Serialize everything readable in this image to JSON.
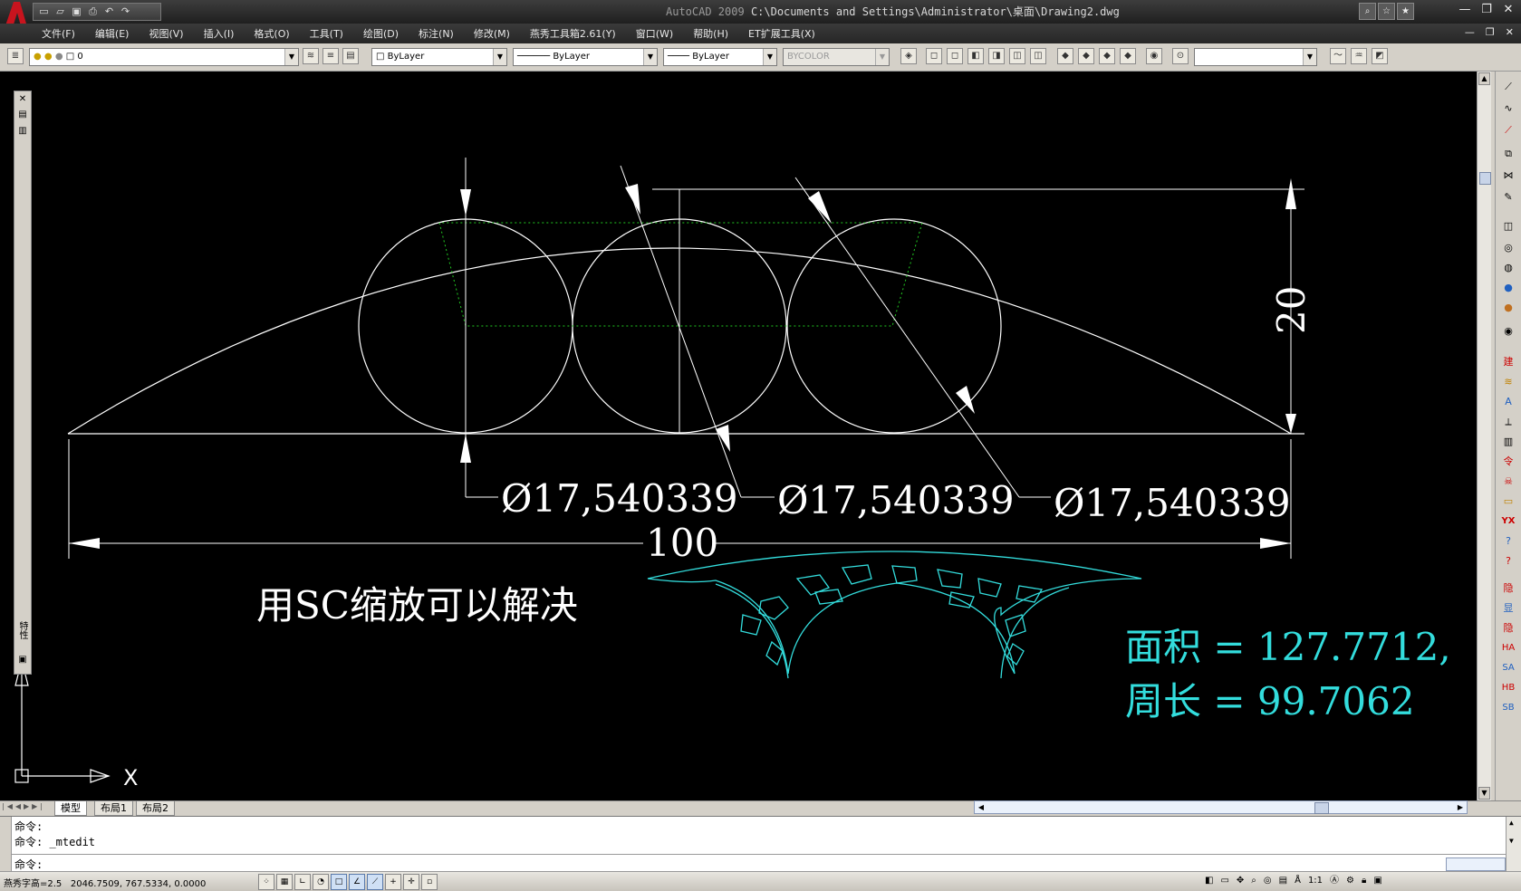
{
  "app": {
    "title_prefix": "AutoCAD 2009",
    "title_path": "C:\\Documents and Settings\\Administrator\\桌面\\Drawing2.dwg",
    "window_buttons": [
      "—",
      "❐",
      "✕"
    ]
  },
  "quick_access": [
    "new-icon",
    "open-icon",
    "save-icon",
    "print-icon",
    "undo-icon",
    "redo-icon"
  ],
  "menu": {
    "items": [
      "文件(F)",
      "编辑(E)",
      "视图(V)",
      "插入(I)",
      "格式(O)",
      "工具(T)",
      "绘图(D)",
      "标注(N)",
      "修改(M)",
      "燕秀工具箱2.61(Y)",
      "窗口(W)",
      "帮助(H)",
      "ET扩展工具(X)"
    ],
    "mdi_buttons": [
      "—",
      "❐",
      "✕"
    ]
  },
  "properties_toolbar": {
    "layer": "0",
    "color": "ByLayer",
    "linetype": "ByLayer",
    "lineweight": "ByLayer",
    "plotstyle": "BYCOLOR"
  },
  "drawing": {
    "dimensions": {
      "diameter_1": "Ø17,540339",
      "diameter_2": "Ø17,540339",
      "diameter_3": "Ø17,540339",
      "width": "100",
      "height": "20"
    },
    "note": "用SC缩放可以解决",
    "area_line": "面积 = 127.7712,",
    "perimeter_line": "周长 = 99.7062",
    "ucs_x_label": "X",
    "colors": {
      "background": "#000000",
      "lines": "#ffffff",
      "construction": "#22cc22",
      "hatch": "#33dddd",
      "measure_text": "#33dddd"
    }
  },
  "palette": {
    "title": "特性"
  },
  "right_toolbar": [
    "建",
    "显",
    "隐",
    "HA",
    "SA",
    "HB",
    "SB",
    "YX"
  ],
  "layout_tabs": [
    "模型",
    "布局1",
    "布局2"
  ],
  "command_line": {
    "line1": "命令:",
    "line2": "命令: _mtedit",
    "prompt": "命令:"
  },
  "status": {
    "text_height": "燕秀字高=2.5",
    "coordinates": "2046.7509,  767.5334,  0.0000",
    "annotation_scale": "1:1"
  }
}
